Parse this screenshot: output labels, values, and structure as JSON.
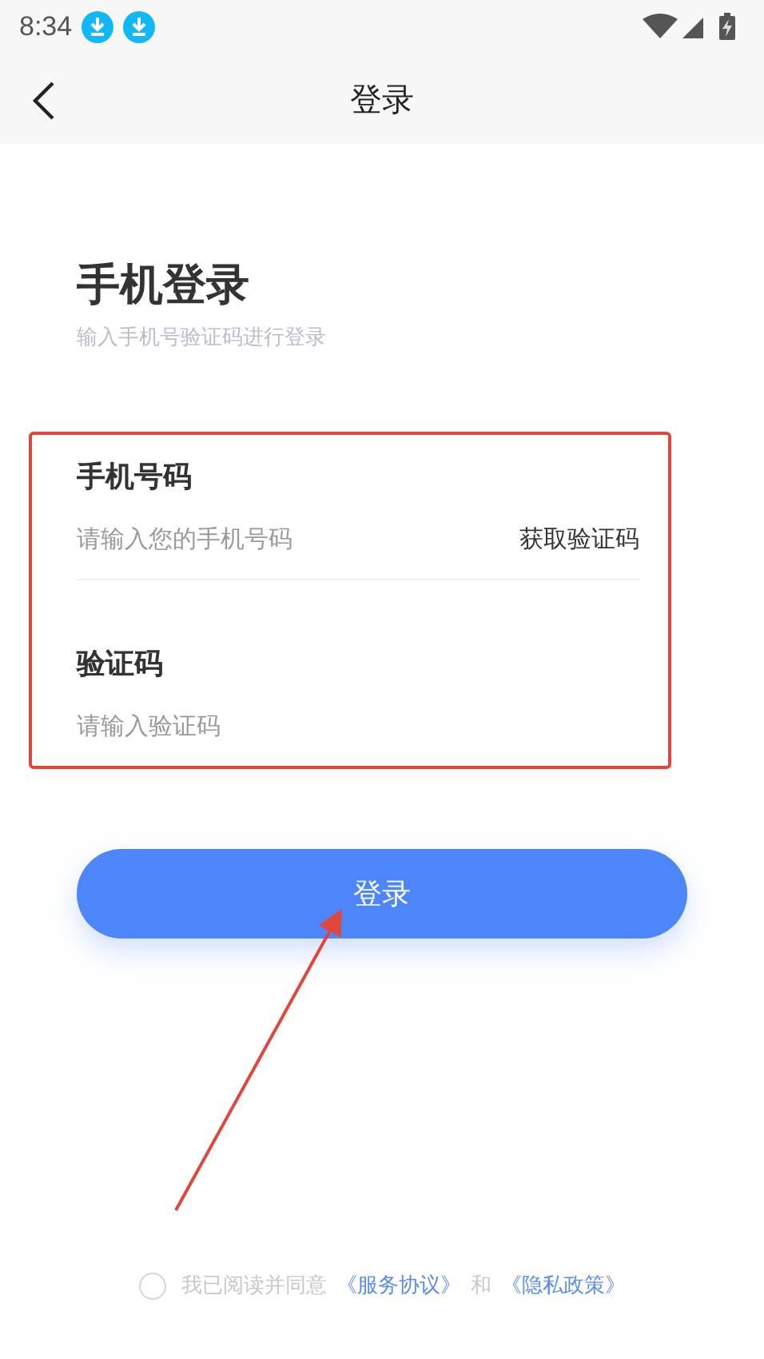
{
  "status_bar": {
    "time": "8:34"
  },
  "nav_bar": {
    "title": "登录"
  },
  "heading": {
    "title": "手机登录",
    "subtitle": "输入手机号验证码进行登录"
  },
  "form": {
    "fields": [
      {
        "label": "手机号码",
        "placeholder": "请输入您的手机号码",
        "action": "获取验证码"
      },
      {
        "label": "验证码",
        "placeholder": "请输入验证码"
      }
    ]
  },
  "login_button": "登录",
  "agreement": {
    "checked": false,
    "text": "我已阅读并同意",
    "link_1": "《服务协议》",
    "joiner": "和",
    "link_2": "《隐私政策》"
  }
}
